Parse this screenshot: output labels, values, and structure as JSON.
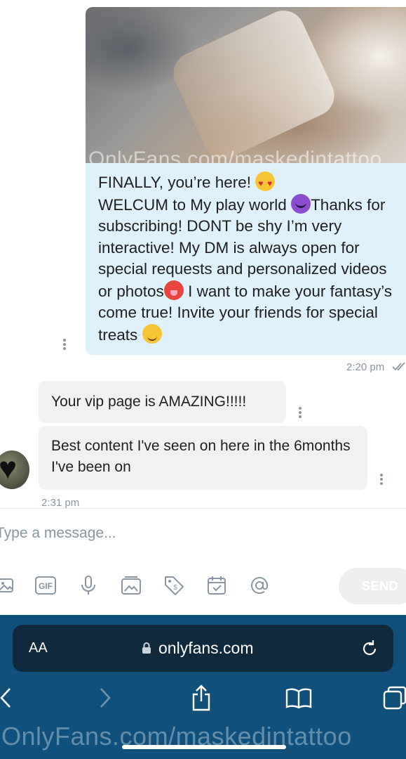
{
  "chat": {
    "photo_watermark": "OnlyFans.com/maskedintattoo",
    "outgoing_message": {
      "lines": [
        "FINALLY, you’re here! ",
        "WELCUM to My play world ",
        "Thanks for subscribing! DONT be shy I’m very interactive! My DM is always open for special requests and personalized videos or photos",
        " I want to make your fantasy’s come true! Invite your friends for special treats "
      ],
      "emojis": [
        "heart-eyes-emoji",
        "devil-emoji",
        "hot-face-emoji",
        "wink-emoji"
      ],
      "time": "2:20 pm",
      "status": "read"
    },
    "incoming_messages": [
      {
        "text": "Your vip page is AMAZING!!!!!"
      },
      {
        "text": "Best content I've seen on here in the 6months I've been on"
      }
    ],
    "incoming_time": "2:31 pm"
  },
  "composer": {
    "placeholder": "Type a message...",
    "tools": [
      "image-icon",
      "gif-icon",
      "microphone-icon",
      "media-vault-icon",
      "price-tag-icon",
      "calendar-icon",
      "mention-icon"
    ],
    "gif_label": "GIF",
    "send_label": "SEND"
  },
  "browser": {
    "text_size_label": "AA",
    "url": "onlyfans.com",
    "watermark": "OnlyFans.com/maskedintattoo"
  },
  "colors": {
    "outgoing_bubble": "#dff1fb",
    "incoming_bubble": "#f0f1f3",
    "browser_bar": "#10507a",
    "url_field": "#0f2a3c",
    "muted_text": "#8a96a3"
  }
}
